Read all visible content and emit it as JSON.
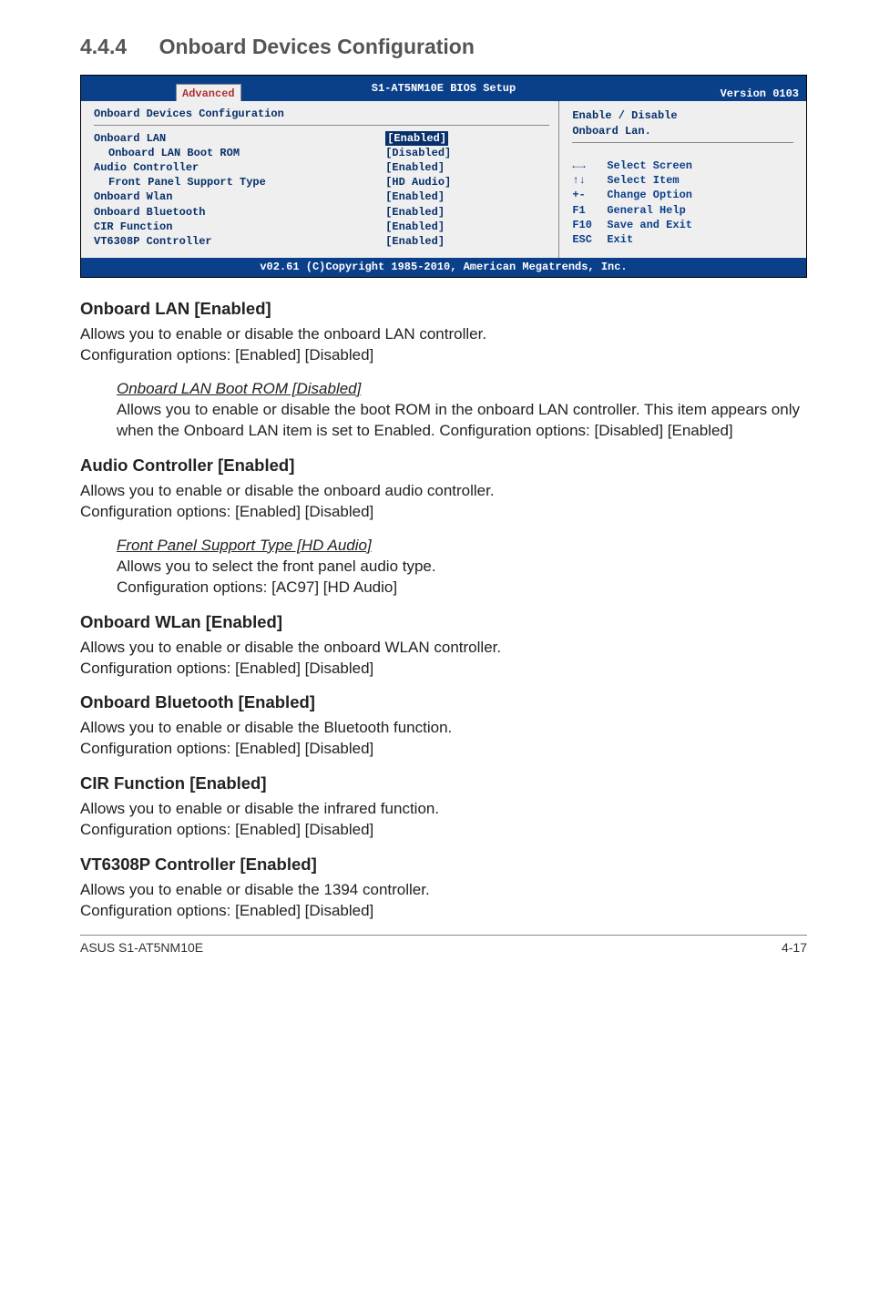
{
  "section": {
    "number": "4.4.4",
    "title": "Onboard Devices Configuration"
  },
  "bios": {
    "header": {
      "center": "S1-AT5NM10E BIOS Setup",
      "right": "Version 0103",
      "tab": "Advanced"
    },
    "left_title": "Onboard Devices Configuration",
    "rows": [
      {
        "label": "Onboard LAN",
        "value": "[Enabled]",
        "selected": true,
        "indent": false
      },
      {
        "label": "Onboard LAN Boot ROM",
        "value": "[Disabled]",
        "selected": false,
        "indent": true
      },
      {
        "label": "Audio Controller",
        "value": "[Enabled]",
        "selected": false,
        "indent": false
      },
      {
        "label": "Front Panel Support Type",
        "value": "[HD Audio]",
        "selected": false,
        "indent": true
      },
      {
        "label": "Onboard Wlan",
        "value": "[Enabled]",
        "selected": false,
        "indent": false
      },
      {
        "label": "Onboard Bluetooth",
        "value": "[Enabled]",
        "selected": false,
        "indent": false
      },
      {
        "label": "CIR Function",
        "value": "[Enabled]",
        "selected": false,
        "indent": false
      },
      {
        "label": "VT6308P Controller",
        "value": "[Enabled]",
        "selected": false,
        "indent": false
      }
    ],
    "help": {
      "line1": "Enable / Disable",
      "line2": "Onboard Lan."
    },
    "nav": [
      {
        "k": "←→",
        "t": "Select Screen"
      },
      {
        "k": "↑↓",
        "t": "Select Item"
      },
      {
        "k": "+-",
        "t": "Change Option"
      },
      {
        "k": "F1",
        "t": "General Help"
      },
      {
        "k": "F10",
        "t": "Save and Exit"
      },
      {
        "k": "ESC",
        "t": "Exit"
      }
    ],
    "footer": "v02.61 (C)Copyright 1985-2010, American Megatrends, Inc."
  },
  "options": [
    {
      "heading": "Onboard LAN [Enabled]",
      "desc": "Allows you to enable or disable the onboard LAN controller.\nConfiguration options: [Enabled] [Disabled]",
      "sub": {
        "title": "Onboard LAN Boot ROM [Disabled]",
        "body": "Allows you to enable or disable the boot ROM in the onboard LAN controller. This item appears only when the Onboard LAN item is set to Enabled. Configuration options: [Disabled] [Enabled]"
      }
    },
    {
      "heading": "Audio Controller [Enabled]",
      "desc": "Allows you to enable or disable the onboard audio controller.\nConfiguration options: [Enabled] [Disabled]",
      "sub": {
        "title": "Front Panel Support Type [HD Audio]",
        "body": "Allows you to select the front panel audio type.\nConfiguration options: [AC97] [HD Audio]"
      }
    },
    {
      "heading": "Onboard WLan [Enabled]",
      "desc": "Allows you to enable or disable the onboard WLAN controller.\nConfiguration options: [Enabled] [Disabled]"
    },
    {
      "heading": "Onboard Bluetooth [Enabled]",
      "desc": "Allows you to enable or disable the Bluetooth function.\nConfiguration options: [Enabled] [Disabled]"
    },
    {
      "heading": "CIR Function [Enabled]",
      "desc": "Allows you to enable or disable the infrared function.\nConfiguration options: [Enabled] [Disabled]"
    },
    {
      "heading": "VT6308P Controller [Enabled]",
      "desc": "Allows you to enable or disable the 1394 controller.\nConfiguration options: [Enabled] [Disabled]"
    }
  ],
  "footer": {
    "left": "ASUS S1-AT5NM10E",
    "right": "4-17"
  }
}
